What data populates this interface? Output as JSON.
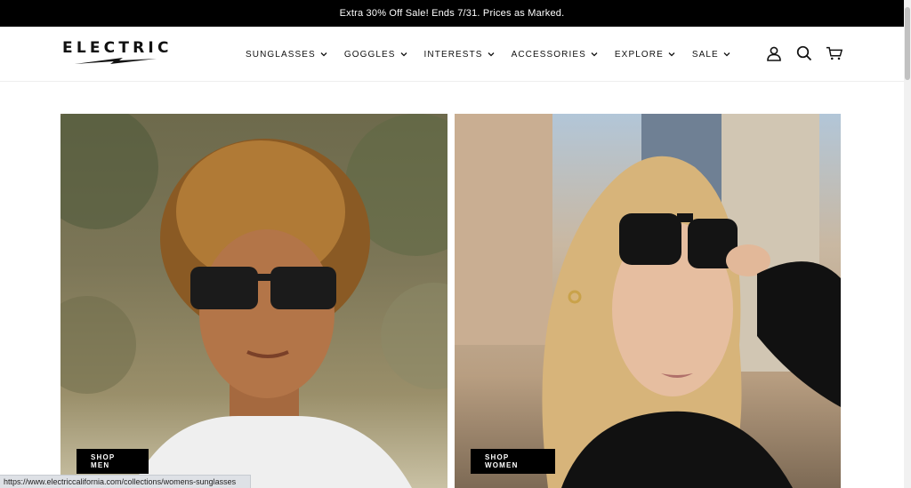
{
  "announcement": {
    "text": "Extra 30% Off Sale! Ends 7/31. Prices as Marked."
  },
  "brand": {
    "logo_text": "ELECTRIC",
    "logo_icon": "lightning-bolt"
  },
  "nav": {
    "items": [
      {
        "label": "SUNGLASSES"
      },
      {
        "label": "GOGGLES"
      },
      {
        "label": "INTERESTS"
      },
      {
        "label": "ACCESSORIES"
      },
      {
        "label": "EXPLORE"
      },
      {
        "label": "SALE"
      }
    ]
  },
  "header_icons": [
    "account-icon",
    "search-icon",
    "cart-icon"
  ],
  "hero": {
    "men": {
      "button_label": "SHOP MEN"
    },
    "women": {
      "button_label": "SHOP WOMEN"
    }
  },
  "status_bar": {
    "url": "https://www.electriccalifornia.com/collections/womens-sunglasses"
  },
  "colors": {
    "announcement_bg": "#000000",
    "button_bg": "#000000",
    "button_text": "#ffffff"
  }
}
